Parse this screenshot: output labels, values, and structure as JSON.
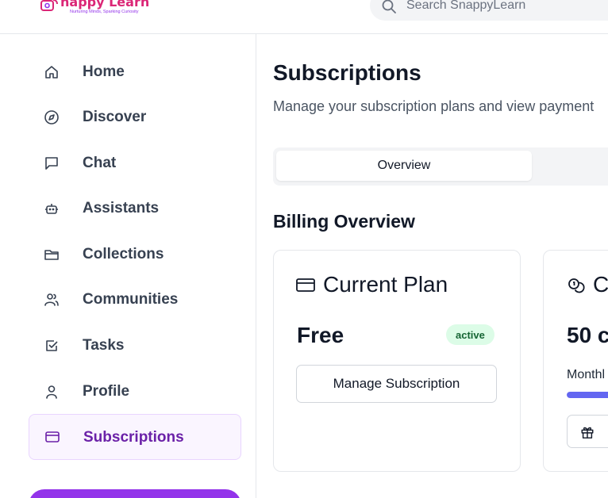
{
  "brand": {
    "name": "nappy Learn",
    "tagline": "Nurturing Minds, Sparking Curiosity",
    "color": "#db2777"
  },
  "search": {
    "placeholder": "Search SnappyLearn"
  },
  "sidebar": {
    "items": [
      {
        "label": "Home",
        "icon": "home-icon"
      },
      {
        "label": "Discover",
        "icon": "compass-icon"
      },
      {
        "label": "Chat",
        "icon": "chat-icon"
      },
      {
        "label": "Assistants",
        "icon": "bot-icon"
      },
      {
        "label": "Collections",
        "icon": "folder-icon"
      },
      {
        "label": "Communities",
        "icon": "users-icon"
      },
      {
        "label": "Tasks",
        "icon": "checkbox-icon"
      },
      {
        "label": "Profile",
        "icon": "user-icon"
      },
      {
        "label": "Subscriptions",
        "icon": "credit-card-icon",
        "active": true
      }
    ],
    "active_color": "#6b21a8"
  },
  "main": {
    "title": "Subscriptions",
    "subtitle": "Manage your subscription plans and view payment",
    "tabs": [
      {
        "label": "Overview",
        "active": true
      }
    ],
    "section_title": "Billing Overview",
    "current_plan": {
      "title": "Current Plan",
      "plan_name": "Free",
      "status": "active",
      "manage_label": "Manage Subscription"
    },
    "credits_card": {
      "title": "C",
      "credits": "50 c",
      "monthly_label": "Monthl",
      "progress_fraction": 1.0
    }
  }
}
